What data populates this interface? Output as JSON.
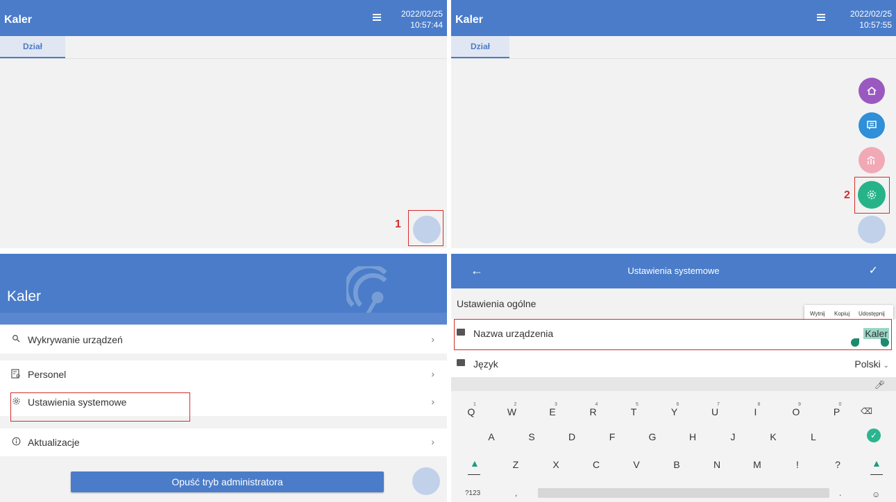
{
  "panel_tl": {
    "app_title": "Kaler",
    "date": "2022/02/25",
    "time": "10:57:44",
    "tab": "Dział",
    "step": "1"
  },
  "panel_tr": {
    "app_title": "Kaler",
    "date": "2022/02/25",
    "time": "10:57:55",
    "tab": "Dział",
    "step": "2",
    "fabs": [
      {
        "icon": "home-icon",
        "color": "#9a59c0"
      },
      {
        "icon": "chat-icon",
        "color": "#2f8fd8"
      },
      {
        "icon": "chart-icon",
        "color": "#f1a9b6"
      },
      {
        "icon": "gear-icon",
        "color": "#27b388"
      }
    ]
  },
  "panel_bl": {
    "app_title": "Kaler",
    "menu": [
      {
        "icon": "search-icon",
        "label": "Wykrywanie urządzeń"
      },
      {
        "icon": "personnel-icon",
        "label": "Personel"
      },
      {
        "icon": "gear-icon",
        "label": "Ustawienia systemowe"
      },
      {
        "icon": "info-icon",
        "label": "Aktualizacje"
      }
    ],
    "exit_button": "Opuść tryb administratora"
  },
  "panel_br": {
    "header_title": "Ustawienia systemowe",
    "section_title": "Ustawienia ogólne",
    "context_menu": [
      "Wytnij",
      "Kopiuj",
      "Udostępnij"
    ],
    "device_name_label": "Nazwa urządzenia",
    "device_name_value": "Kaler",
    "language_label": "Język",
    "language_value": "Polski",
    "keyboard": {
      "row1": [
        "Q",
        "W",
        "E",
        "R",
        "T",
        "Y",
        "U",
        "I",
        "O",
        "P"
      ],
      "row1_nums": [
        "1",
        "2",
        "3",
        "4",
        "5",
        "6",
        "7",
        "8",
        "9",
        "0"
      ],
      "row2": [
        "A",
        "S",
        "D",
        "F",
        "G",
        "H",
        "J",
        "K",
        "L"
      ],
      "row3": [
        "Z",
        "X",
        "C",
        "V",
        "B",
        "N",
        "M",
        "!",
        "?"
      ],
      "sym_key": "?123",
      "comma": ",",
      "period": "."
    }
  },
  "colors": {
    "brand_blue": "#4a7cc9",
    "highlight_red": "#d32d2d",
    "fab_idle": "#c2d1ea"
  }
}
